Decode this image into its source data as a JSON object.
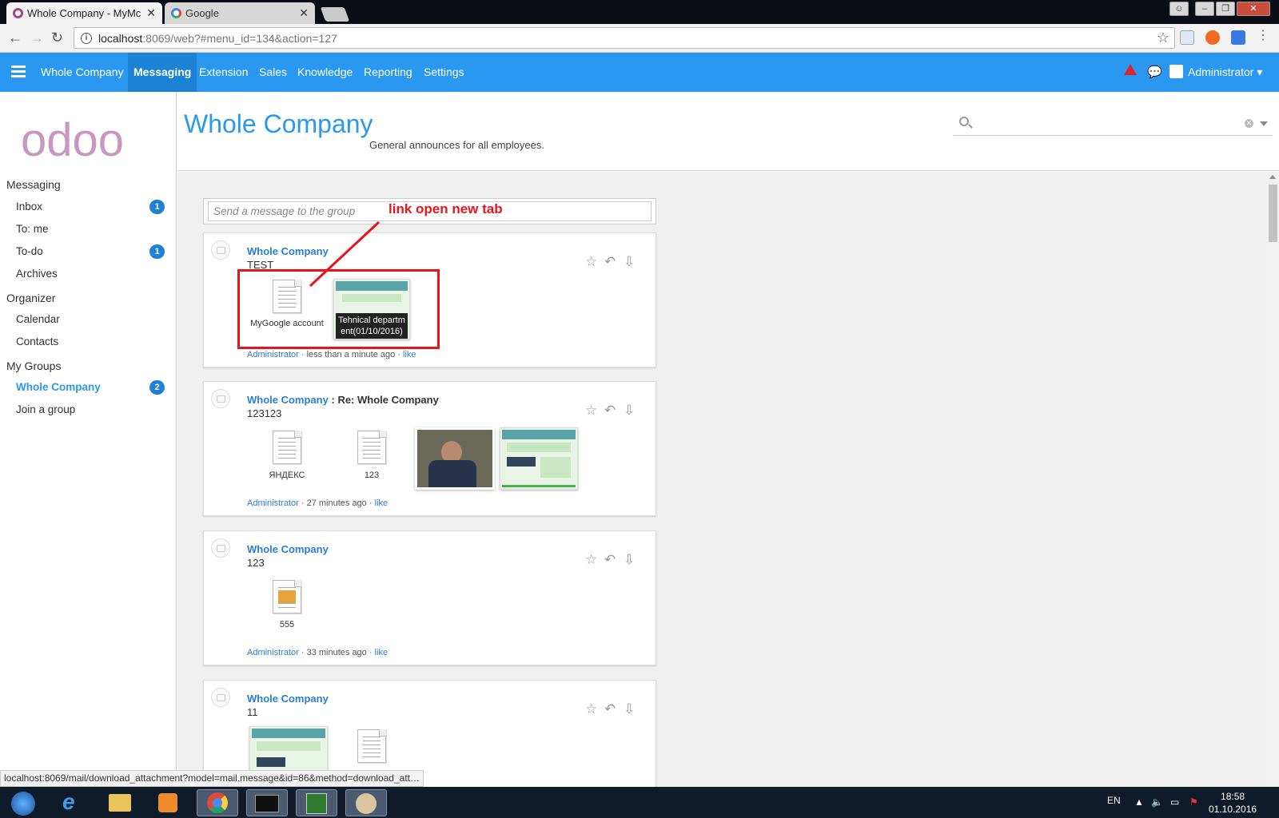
{
  "browser": {
    "tabs": [
      {
        "title": "Whole Company - MyMc",
        "active": true
      },
      {
        "title": "Google",
        "active": false
      }
    ],
    "url_host": "localhost",
    "url_rest": ":8069/web?#menu_id=134&action=127",
    "status_link": "localhost:8069/mail/download_attachment?model=mail.message&id=86&method=download_att…"
  },
  "topnav": {
    "brand": "Whole Company",
    "items": [
      "Messaging",
      "Extension",
      "Sales",
      "Knowledge",
      "Reporting",
      "Settings"
    ],
    "active_item": "Messaging",
    "user": "Administrator"
  },
  "sidebar": {
    "logo": "odoo",
    "sections": [
      {
        "title": "Messaging",
        "items": [
          {
            "label": "Inbox",
            "badge": "1"
          },
          {
            "label": "To: me",
            "badge": ""
          },
          {
            "label": "To-do",
            "badge": "1"
          },
          {
            "label": "Archives",
            "badge": ""
          }
        ]
      },
      {
        "title": "Organizer",
        "items": [
          {
            "label": "Calendar",
            "badge": ""
          },
          {
            "label": "Contacts",
            "badge": ""
          }
        ]
      },
      {
        "title": "My Groups",
        "items": [
          {
            "label": "Whole Company",
            "badge": "2",
            "active": true
          },
          {
            "label": "Join a group",
            "badge": ""
          }
        ]
      }
    ]
  },
  "header": {
    "title": "Whole Company",
    "subtitle": "General announces for all employees."
  },
  "composer": {
    "placeholder": "Send a message to the group"
  },
  "messages": [
    {
      "group": "Whole Company",
      "subject": "",
      "body": "TEST",
      "attachments": [
        {
          "name": "MyGoogle account",
          "kind": "doc"
        },
        {
          "name": "Tehnical departm ent(01/10/2016)",
          "kind": "thumb"
        }
      ],
      "author": "Administrator",
      "time": "less than a minute ago",
      "like": "like"
    },
    {
      "group": "Whole Company",
      "subject": "Re: Whole Company",
      "body": "123123",
      "attachments": [
        {
          "name": "ЯНДЕКС",
          "kind": "doc"
        },
        {
          "name": "123",
          "kind": "doc"
        },
        {
          "name": "",
          "kind": "photo"
        },
        {
          "name": "",
          "kind": "thumb"
        }
      ],
      "author": "Administrator",
      "time": "27 minutes ago",
      "like": "like"
    },
    {
      "group": "Whole Company",
      "subject": "",
      "body": "123",
      "attachments": [
        {
          "name": "555",
          "kind": "doc-image"
        }
      ],
      "author": "Administrator",
      "time": "33 minutes ago",
      "like": "like"
    },
    {
      "group": "Whole Company",
      "subject": "",
      "body": "11",
      "attachments": [
        {
          "name": "",
          "kind": "thumb"
        },
        {
          "name": "",
          "kind": "doc"
        }
      ]
    }
  ],
  "annotation": {
    "text": "link open new tab",
    "color": "#e8141a"
  },
  "taskbar": {
    "lang": "EN",
    "time": "18:58",
    "date": "01.10.2016"
  },
  "colors": {
    "primary": "#2a98f0",
    "active_nav": "#1b82d6",
    "badge": "#1f80d5"
  }
}
